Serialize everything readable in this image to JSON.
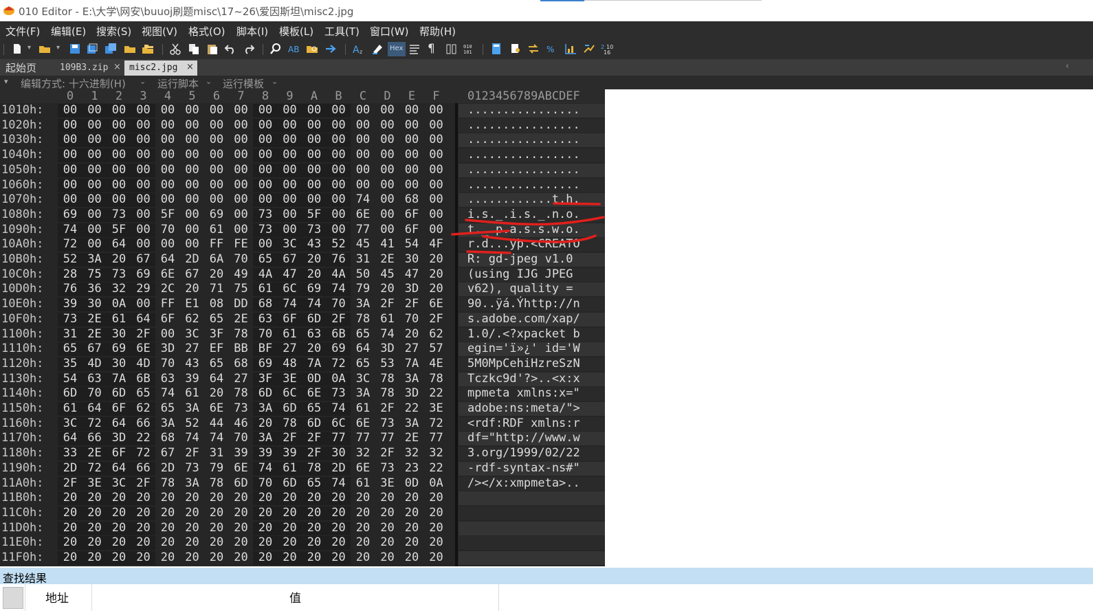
{
  "window": {
    "title": "010 Editor - E:\\大学\\网安\\buuoj刷题misc\\17~26\\爱因斯坦\\misc2.jpg"
  },
  "menu": [
    "文件(F)",
    "编辑(E)",
    "搜索(S)",
    "视图(V)",
    "格式(O)",
    "脚本(I)",
    "模板(L)",
    "工具(T)",
    "窗口(W)",
    "帮助(H)"
  ],
  "toolbar": {
    "icons": [
      "new-file-icon",
      "open-folder-icon",
      "save-icon",
      "save-as-icon",
      "save-all-icon",
      "open-folder2-icon",
      "open-multiple-icon",
      "cut-icon",
      "copy-icon",
      "paste-icon",
      "undo-icon",
      "redo-icon",
      "find-icon",
      "find-replace-icon",
      "find-in-files-icon",
      "goto-icon",
      "font-icon",
      "highlight-icon",
      "hex-mode-icon",
      "text-mode-icon",
      "pilcrow-icon",
      "columns-icon",
      "binary-icon",
      "calculator-icon",
      "inspector-icon",
      "compare-icon",
      "sort-icon",
      "histogram-icon",
      "checksum-icon",
      "base-convert-icon"
    ],
    "hex_label": "Hex"
  },
  "tabs": {
    "start": "起始页",
    "file1": "109B3.zip",
    "file2": "misc2.jpg",
    "close": "×"
  },
  "editor_header": {
    "edit_mode": "编辑方式: 十六进制(H)",
    "run_script": "运行脚本",
    "run_template": "运行模板"
  },
  "columns": [
    "0",
    "1",
    "2",
    "3",
    "4",
    "5",
    "6",
    "7",
    "8",
    "9",
    "A",
    "B",
    "C",
    "D",
    "E",
    "F"
  ],
  "ascii_header": "0123456789ABCDEF",
  "rows": [
    {
      "addr": "1010h:",
      "hex": "00 00 00 00 00 00 00 00 00 00 00 00 00 00 00 00",
      "ascii": "................"
    },
    {
      "addr": "1020h:",
      "hex": "00 00 00 00 00 00 00 00 00 00 00 00 00 00 00 00",
      "ascii": "................"
    },
    {
      "addr": "1030h:",
      "hex": "00 00 00 00 00 00 00 00 00 00 00 00 00 00 00 00",
      "ascii": "................"
    },
    {
      "addr": "1040h:",
      "hex": "00 00 00 00 00 00 00 00 00 00 00 00 00 00 00 00",
      "ascii": "................"
    },
    {
      "addr": "1050h:",
      "hex": "00 00 00 00 00 00 00 00 00 00 00 00 00 00 00 00",
      "ascii": "................"
    },
    {
      "addr": "1060h:",
      "hex": "00 00 00 00 00 00 00 00 00 00 00 00 00 00 00 00",
      "ascii": "................"
    },
    {
      "addr": "1070h:",
      "hex": "00 00 00 00 00 00 00 00 00 00 00 00 74 00 68 00",
      "ascii": "............t.h."
    },
    {
      "addr": "1080h:",
      "hex": "69 00 73 00 5F 00 69 00 73 00 5F 00 6E 00 6F 00",
      "ascii": "i.s._.i.s._.n.o."
    },
    {
      "addr": "1090h:",
      "hex": "74 00 5F 00 70 00 61 00 73 00 73 00 77 00 6F 00",
      "ascii": "t._.p.a.s.s.w.o."
    },
    {
      "addr": "10A0h:",
      "hex": "72 00 64 00 00 00 FF FE 00 3C 43 52 45 41 54 4F",
      "ascii": "r.d...ÿþ.<CREATO"
    },
    {
      "addr": "10B0h:",
      "hex": "52 3A 20 67 64 2D 6A 70 65 67 20 76 31 2E 30 20",
      "ascii": "R: gd-jpeg v1.0 "
    },
    {
      "addr": "10C0h:",
      "hex": "28 75 73 69 6E 67 20 49 4A 47 20 4A 50 45 47 20",
      "ascii": "(using IJG JPEG "
    },
    {
      "addr": "10D0h:",
      "hex": "76 36 32 29 2C 20 71 75 61 6C 69 74 79 20 3D 20",
      "ascii": "v62), quality = "
    },
    {
      "addr": "10E0h:",
      "hex": "39 30 0A 00 FF E1 08 DD 68 74 74 70 3A 2F 2F 6E",
      "ascii": "90..ÿá.Ýhttp://n"
    },
    {
      "addr": "10F0h:",
      "hex": "73 2E 61 64 6F 62 65 2E 63 6F 6D 2F 78 61 70 2F",
      "ascii": "s.adobe.com/xap/"
    },
    {
      "addr": "1100h:",
      "hex": "31 2E 30 2F 00 3C 3F 78 70 61 63 6B 65 74 20 62",
      "ascii": "1.0/.<?xpacket b"
    },
    {
      "addr": "1110h:",
      "hex": "65 67 69 6E 3D 27 EF BB BF 27 20 69 64 3D 27 57",
      "ascii": "egin='ï»¿' id='W"
    },
    {
      "addr": "1120h:",
      "hex": "35 4D 30 4D 70 43 65 68 69 48 7A 72 65 53 7A 4E",
      "ascii": "5M0MpCehiHzreSzN"
    },
    {
      "addr": "1130h:",
      "hex": "54 63 7A 6B 63 39 64 27 3F 3E 0D 0A 3C 78 3A 78",
      "ascii": "Tczkc9d'?>..<x:x"
    },
    {
      "addr": "1140h:",
      "hex": "6D 70 6D 65 74 61 20 78 6D 6C 6E 73 3A 78 3D 22",
      "ascii": "mpmeta xmlns:x=\""
    },
    {
      "addr": "1150h:",
      "hex": "61 64 6F 62 65 3A 6E 73 3A 6D 65 74 61 2F 22 3E",
      "ascii": "adobe:ns:meta/\">"
    },
    {
      "addr": "1160h:",
      "hex": "3C 72 64 66 3A 52 44 46 20 78 6D 6C 6E 73 3A 72",
      "ascii": "<rdf:RDF xmlns:r"
    },
    {
      "addr": "1170h:",
      "hex": "64 66 3D 22 68 74 74 70 3A 2F 2F 77 77 77 2E 77",
      "ascii": "df=\"http://www.w"
    },
    {
      "addr": "1180h:",
      "hex": "33 2E 6F 72 67 2F 31 39 39 39 2F 30 32 2F 32 32",
      "ascii": "3.org/1999/02/22"
    },
    {
      "addr": "1190h:",
      "hex": "2D 72 64 66 2D 73 79 6E 74 61 78 2D 6E 73 23 22",
      "ascii": "-rdf-syntax-ns#\""
    },
    {
      "addr": "11A0h:",
      "hex": "2F 3E 3C 2F 78 3A 78 6D 70 6D 65 74 61 3E 0D 0A",
      "ascii": "/></x:xmpmeta>.."
    },
    {
      "addr": "11B0h:",
      "hex": "20 20 20 20 20 20 20 20 20 20 20 20 20 20 20 20",
      "ascii": "                "
    },
    {
      "addr": "11C0h:",
      "hex": "20 20 20 20 20 20 20 20 20 20 20 20 20 20 20 20",
      "ascii": "                "
    },
    {
      "addr": "11D0h:",
      "hex": "20 20 20 20 20 20 20 20 20 20 20 20 20 20 20 20",
      "ascii": "                "
    },
    {
      "addr": "11E0h:",
      "hex": "20 20 20 20 20 20 20 20 20 20 20 20 20 20 20 20",
      "ascii": "                "
    },
    {
      "addr": "11F0h:",
      "hex": "20 20 20 20 20 20 20 20 20 20 20 20 20 20 20 20",
      "ascii": "                "
    }
  ],
  "find_panel": {
    "title": "查找结果",
    "col_address": "地址",
    "col_value": "值"
  },
  "colors": {
    "annotation_red": "#e0201c",
    "find_bar": "#c2dff3",
    "editor_bg": "#262626"
  }
}
